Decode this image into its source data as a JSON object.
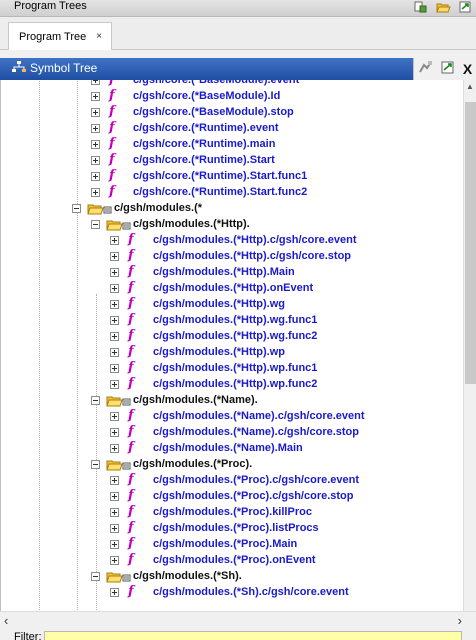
{
  "program_trees": {
    "title": "Program Trees"
  },
  "tab": {
    "label": "Program Tree",
    "close": "×"
  },
  "symbol_tree": {
    "title": "Symbol Tree",
    "close": "X"
  },
  "filter": {
    "label": "Filter:"
  },
  "tree": {
    "rows": [
      {
        "type": "func",
        "depth": 3,
        "label": "c/gsh/core.(*BaseModule).event"
      },
      {
        "type": "func",
        "depth": 3,
        "label": "c/gsh/core.(*BaseModule).Id"
      },
      {
        "type": "func",
        "depth": 3,
        "label": "c/gsh/core.(*BaseModule).stop"
      },
      {
        "type": "func",
        "depth": 3,
        "label": "c/gsh/core.(*Runtime).event"
      },
      {
        "type": "func",
        "depth": 3,
        "label": "c/gsh/core.(*Runtime).main"
      },
      {
        "type": "func",
        "depth": 3,
        "label": "c/gsh/core.(*Runtime).Start"
      },
      {
        "type": "func",
        "depth": 3,
        "label": "c/gsh/core.(*Runtime).Start.func1"
      },
      {
        "type": "func",
        "depth": 3,
        "label": "c/gsh/core.(*Runtime).Start.func2"
      },
      {
        "type": "ns",
        "depth": 2,
        "label": "c/gsh/modules.(*"
      },
      {
        "type": "ns",
        "depth": 3,
        "label": "c/gsh/modules.(*Http)."
      },
      {
        "type": "func",
        "depth": 4,
        "label": "c/gsh/modules.(*Http).c/gsh/core.event"
      },
      {
        "type": "func",
        "depth": 4,
        "label": "c/gsh/modules.(*Http).c/gsh/core.stop"
      },
      {
        "type": "func",
        "depth": 4,
        "label": "c/gsh/modules.(*Http).Main"
      },
      {
        "type": "func",
        "depth": 4,
        "label": "c/gsh/modules.(*Http).onEvent"
      },
      {
        "type": "func",
        "depth": 4,
        "label": "c/gsh/modules.(*Http).wg"
      },
      {
        "type": "func",
        "depth": 4,
        "label": "c/gsh/modules.(*Http).wg.func1"
      },
      {
        "type": "func",
        "depth": 4,
        "label": "c/gsh/modules.(*Http).wg.func2"
      },
      {
        "type": "func",
        "depth": 4,
        "label": "c/gsh/modules.(*Http).wp"
      },
      {
        "type": "func",
        "depth": 4,
        "label": "c/gsh/modules.(*Http).wp.func1"
      },
      {
        "type": "func",
        "depth": 4,
        "label": "c/gsh/modules.(*Http).wp.func2"
      },
      {
        "type": "ns",
        "depth": 3,
        "label": "c/gsh/modules.(*Name)."
      },
      {
        "type": "func",
        "depth": 4,
        "label": "c/gsh/modules.(*Name).c/gsh/core.event"
      },
      {
        "type": "func",
        "depth": 4,
        "label": "c/gsh/modules.(*Name).c/gsh/core.stop"
      },
      {
        "type": "func",
        "depth": 4,
        "label": "c/gsh/modules.(*Name).Main"
      },
      {
        "type": "ns",
        "depth": 3,
        "label": "c/gsh/modules.(*Proc)."
      },
      {
        "type": "func",
        "depth": 4,
        "label": "c/gsh/modules.(*Proc).c/gsh/core.event"
      },
      {
        "type": "func",
        "depth": 4,
        "label": "c/gsh/modules.(*Proc).c/gsh/core.stop"
      },
      {
        "type": "func",
        "depth": 4,
        "label": "c/gsh/modules.(*Proc).killProc"
      },
      {
        "type": "func",
        "depth": 4,
        "label": "c/gsh/modules.(*Proc).listProcs"
      },
      {
        "type": "func",
        "depth": 4,
        "label": "c/gsh/modules.(*Proc).Main"
      },
      {
        "type": "func",
        "depth": 4,
        "label": "c/gsh/modules.(*Proc).onEvent"
      },
      {
        "type": "ns",
        "depth": 3,
        "label": "c/gsh/modules.(*Sh)."
      },
      {
        "type": "func",
        "depth": 4,
        "label": "c/gsh/modules.(*Sh).c/gsh/core.event"
      }
    ]
  }
}
